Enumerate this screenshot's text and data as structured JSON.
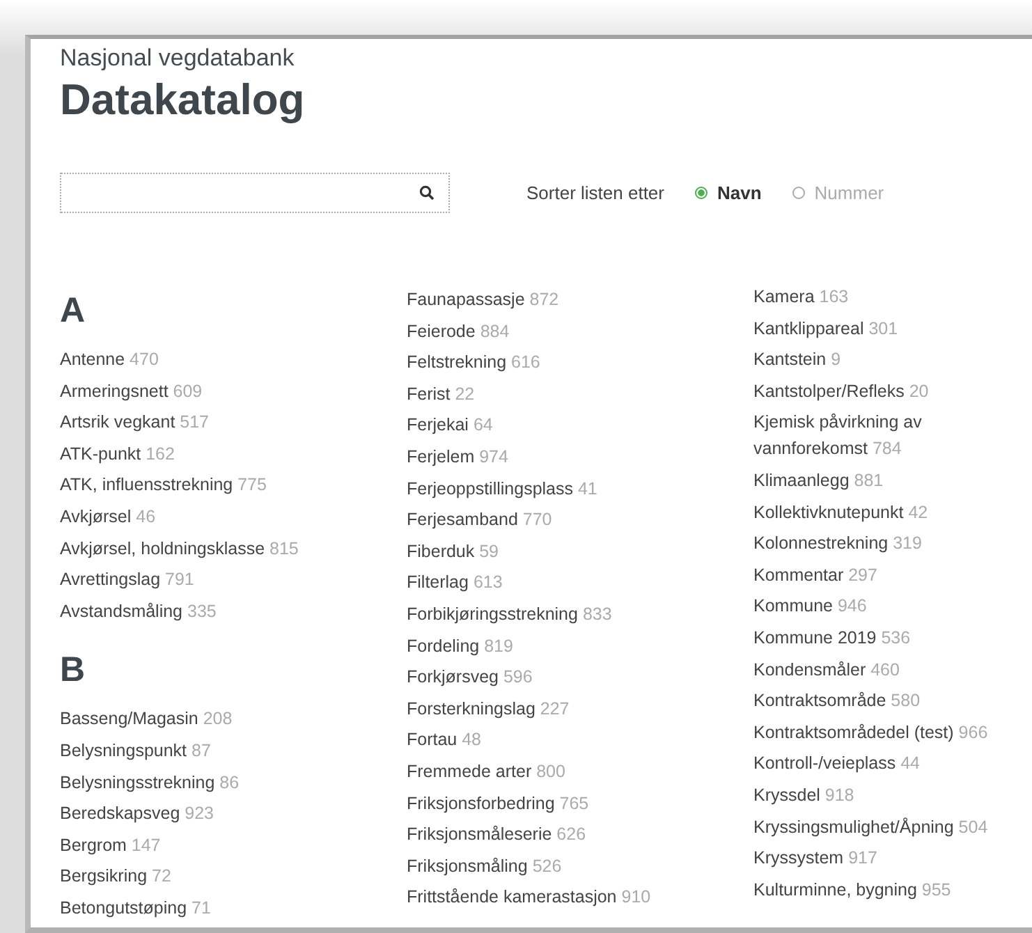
{
  "header": {
    "subtitle": "Nasjonal vegdatabank",
    "title": "Datakatalog"
  },
  "sort": {
    "label": "Sorter listen etter",
    "options": [
      {
        "label": "Navn",
        "selected": true
      },
      {
        "label": "Nummer",
        "selected": false
      }
    ]
  },
  "columns": [
    {
      "sections": [
        {
          "letter": "A",
          "items": [
            {
              "name": "Antenne",
              "number": "470"
            },
            {
              "name": "Armeringsnett",
              "number": "609"
            },
            {
              "name": "Artsrik vegkant",
              "number": "517"
            },
            {
              "name": "ATK-punkt",
              "number": "162"
            },
            {
              "name": "ATK, influensstrekning",
              "number": "775"
            },
            {
              "name": "Avkjørsel",
              "number": "46"
            },
            {
              "name": "Avkjørsel, holdningsklasse",
              "number": "815"
            },
            {
              "name": "Avrettingslag",
              "number": "791"
            },
            {
              "name": "Avstandsmåling",
              "number": "335"
            }
          ]
        },
        {
          "letter": "B",
          "items": [
            {
              "name": "Basseng/Magasin",
              "number": "208"
            },
            {
              "name": "Belysningspunkt",
              "number": "87"
            },
            {
              "name": "Belysningsstrekning",
              "number": "86"
            },
            {
              "name": "Beredskapsveg",
              "number": "923"
            },
            {
              "name": "Bergrom",
              "number": "147"
            },
            {
              "name": "Bergsikring",
              "number": "72"
            },
            {
              "name": "Betongutstøping",
              "number": "71"
            }
          ]
        }
      ]
    },
    {
      "sections": [
        {
          "items": [
            {
              "name": "Faunapassasje",
              "number": "872"
            },
            {
              "name": "Feierode",
              "number": "884"
            },
            {
              "name": "Feltstrekning",
              "number": "616"
            },
            {
              "name": "Ferist",
              "number": "22"
            },
            {
              "name": "Ferjekai",
              "number": "64"
            },
            {
              "name": "Ferjelem",
              "number": "974"
            },
            {
              "name": "Ferjeoppstillingsplass",
              "number": "41"
            },
            {
              "name": "Ferjesamband",
              "number": "770"
            },
            {
              "name": "Fiberduk",
              "number": "59"
            },
            {
              "name": "Filterlag",
              "number": "613"
            },
            {
              "name": "Forbikjøringsstrekning",
              "number": "833"
            },
            {
              "name": "Fordeling",
              "number": "819"
            },
            {
              "name": "Forkjørsveg",
              "number": "596"
            },
            {
              "name": "Forsterkningslag",
              "number": "227"
            },
            {
              "name": "Fortau",
              "number": "48"
            },
            {
              "name": "Fremmede arter",
              "number": "800"
            },
            {
              "name": "Friksjonsforbedring",
              "number": "765"
            },
            {
              "name": "Friksjonsmåleserie",
              "number": "626"
            },
            {
              "name": "Friksjonsmåling",
              "number": "526"
            },
            {
              "name": "Frittstående kamerastasjon",
              "number": "910"
            }
          ]
        }
      ]
    },
    {
      "sections": [
        {
          "items": [
            {
              "name": "Kamera",
              "number": "163"
            },
            {
              "name": "Kantklippareal",
              "number": "301"
            },
            {
              "name": "Kantstein",
              "number": "9"
            },
            {
              "name": "Kantstolper/Refleks",
              "number": "20"
            },
            {
              "name": "Kjemisk påvirkning av vannforekomst",
              "number": "784"
            },
            {
              "name": "Klimaanlegg",
              "number": "881"
            },
            {
              "name": "Kollektivknutepunkt",
              "number": "42"
            },
            {
              "name": "Kolonnestrekning",
              "number": "319"
            },
            {
              "name": "Kommentar",
              "number": "297"
            },
            {
              "name": "Kommune",
              "number": "946"
            },
            {
              "name": "Kommune 2019",
              "number": "536"
            },
            {
              "name": "Kondensmåler",
              "number": "460"
            },
            {
              "name": "Kontraktsområde",
              "number": "580"
            },
            {
              "name": "Kontraktsområdedel (test)",
              "number": "966"
            },
            {
              "name": "Kontroll-/veieplass",
              "number": "44"
            },
            {
              "name": "Kryssdel",
              "number": "918"
            },
            {
              "name": "Kryssingsmulighet/Åpning",
              "number": "504"
            },
            {
              "name": "Kryssystem",
              "number": "917"
            },
            {
              "name": "Kulturminne, bygning",
              "number": "955"
            }
          ]
        }
      ]
    }
  ]
}
